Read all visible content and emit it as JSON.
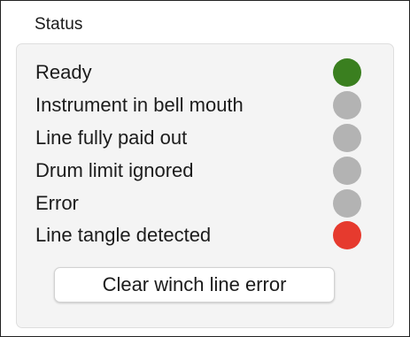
{
  "status_group": {
    "title": "Status",
    "items": [
      {
        "label": "Ready",
        "indicator_color": "#3a7f1f",
        "state": "green"
      },
      {
        "label": "Instrument in bell mouth",
        "indicator_color": "#b3b3b3",
        "state": "off"
      },
      {
        "label": "Line fully paid out",
        "indicator_color": "#b3b3b3",
        "state": "off"
      },
      {
        "label": "Drum limit ignored",
        "indicator_color": "#b3b3b3",
        "state": "off"
      },
      {
        "label": "Error",
        "indicator_color": "#b3b3b3",
        "state": "off"
      },
      {
        "label": "Line tangle detected",
        "indicator_color": "#e63a2e",
        "state": "red"
      }
    ],
    "clear_button_label": "Clear winch line error"
  }
}
